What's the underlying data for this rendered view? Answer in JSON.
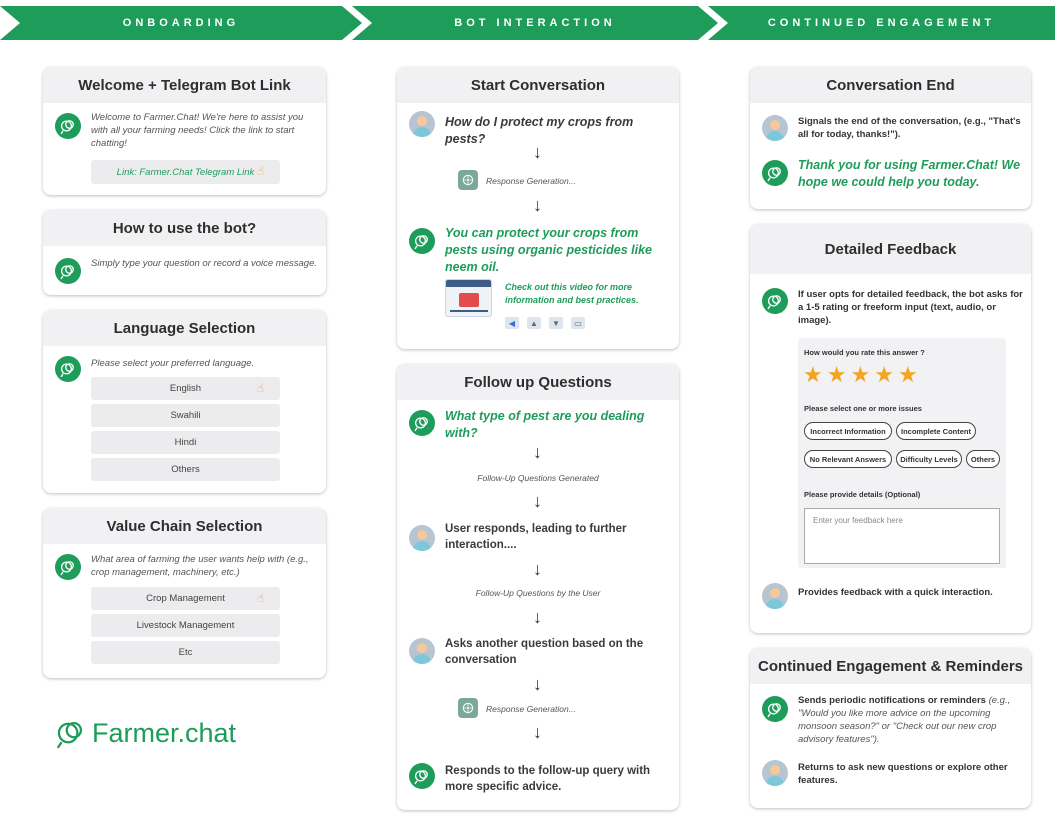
{
  "header": {
    "stage1": "ONBOARDING",
    "stage2": "BOT INTERACTION",
    "stage3": "CONTINUED ENGAGEMENT"
  },
  "colors": {
    "accent": "#1e9c5a",
    "star": "#f3a421"
  },
  "onboarding": {
    "welcome": {
      "title": "Welcome + Telegram Bot Link",
      "text": "Welcome to Farmer.Chat! We're here to assist you with all your farming needs! Click the link to start chatting!",
      "link": "Link: Farmer.Chat Telegram Link"
    },
    "howto": {
      "title": "How to use the bot?",
      "text": "Simply type your question or record a voice message."
    },
    "language": {
      "title": "Language Selection",
      "text": "Please select your preferred language.",
      "options": [
        "English",
        "Swahili",
        "Hindi",
        "Others"
      ]
    },
    "valuechain": {
      "title": "Value Chain Selection",
      "text": "What area of farming the user wants help with (e.g., crop management, machinery, etc.)",
      "options": [
        "Crop Management",
        "Livestock Management",
        "Etc"
      ]
    },
    "logo": "Farmer.chat"
  },
  "interaction": {
    "start": {
      "title": "Start Conversation",
      "user_q": "How do I protect my crops from pests?",
      "gen": "Response Generation...",
      "bot_a": "You can protect your crops from pests using organic pesticides like neem oil.",
      "video": "Check out this video for more information and best practices."
    },
    "followup": {
      "title": "Follow up Questions",
      "bot_q": "What type of pest are you dealing with?",
      "gen1": "Follow-Up Questions Generated",
      "user_resp": "User responds, leading to further interaction....",
      "gen2": "Follow-Up Questions by the User",
      "user_ask": "Asks another question based on the conversation",
      "gen3": "Response Generation...",
      "bot_resp": "Responds to the follow-up query with more specific advice."
    }
  },
  "engagement": {
    "end": {
      "title": "Conversation End",
      "user_text": "Signals the end of the conversation, (e.g., \"That's all for today, thanks!\").",
      "bot_text": "Thank you for using Farmer.Chat! We hope we could help you today."
    },
    "feedback": {
      "title": "Detailed Feedback",
      "bot_text": "If user opts for detailed feedback, the bot asks for a 1-5 rating or freeform input (text, audio, or image).",
      "rate_label": "How would you rate this answer ?",
      "rating": 5,
      "issues_label": "Please select one or more issues",
      "chips": [
        "Incorrect Information",
        "Incomplete Content",
        "No Relevant Answers",
        "Difficulty Levels",
        "Others"
      ],
      "details_label": "Please provide details (Optional)",
      "placeholder": "Enter your feedback here",
      "user_text": "Provides feedback with a quick interaction."
    },
    "reminders": {
      "title": "Continued Engagement & Reminders",
      "bot_text_bold": "Sends periodic notifications or reminders",
      "bot_text_italic": " (e.g., \"Would you like more advice on the upcoming monsoon season?\" or \"Check out our new crop advisory features\").",
      "user_text": "Returns to ask new questions or explore other features."
    }
  }
}
